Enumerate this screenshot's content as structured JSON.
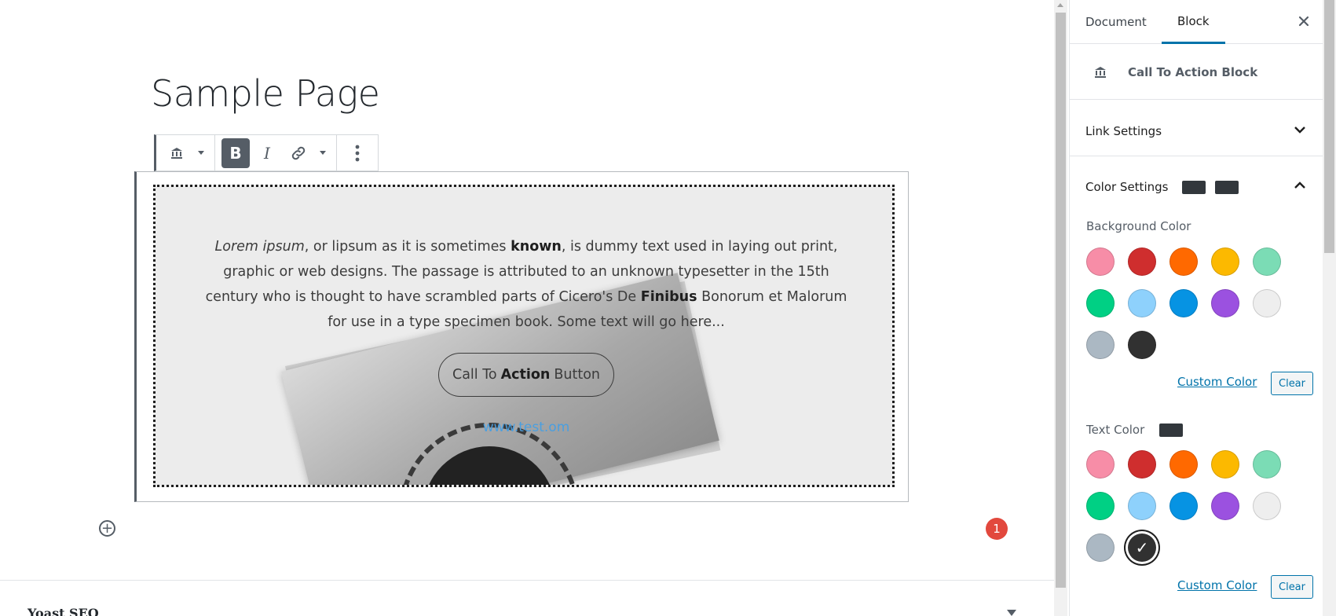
{
  "page": {
    "title": "Sample Page"
  },
  "toolbar": {
    "block_icon": "bank-icon",
    "bold_label": "B",
    "italic_label": "I"
  },
  "cta": {
    "text_parts": [
      {
        "t": "Lorem ipsum",
        "style": "italic"
      },
      {
        "t": ", or lipsum as it is sometimes ",
        "style": "normal"
      },
      {
        "t": "known",
        "style": "bold"
      },
      {
        "t": ", is dummy text used in laying out print, graphic or web designs. The passage is attributed to an unknown typesetter in the 15th century who is thought to have scrambled parts of Cicero's De ",
        "style": "normal"
      },
      {
        "t": "Finibus",
        "style": "bold"
      },
      {
        "t": " Bonorum et Malorum for use in a type specimen book.  Some text will go here...",
        "style": "normal"
      }
    ],
    "button_pre": "Call To",
    "button_bold": "Action",
    "button_post": "Button",
    "link_text": "www.test.om"
  },
  "editor": {
    "notification_count": "1",
    "yoast_label": "Yoast SEO"
  },
  "sidebar": {
    "tabs": [
      {
        "label": "Document",
        "active": false
      },
      {
        "label": "Block",
        "active": true
      }
    ],
    "block_card_title": "Call To Action Block",
    "link_settings_label": "Link Settings",
    "color_settings_label": "Color Settings",
    "background": {
      "label": "Background Color",
      "colors": [
        "#f78da7",
        "#cf2e2e",
        "#ff6900",
        "#fcb900",
        "#7bdcb5",
        "#00d084",
        "#8ed1fc",
        "#0693e3",
        "#9b51e0",
        "#eeeeee",
        "#abb8c3",
        "#313131"
      ],
      "selected_index": -1,
      "custom_label": "Custom Color",
      "clear_label": "Clear"
    },
    "text": {
      "label": "Text Color",
      "colors": [
        "#f78da7",
        "#cf2e2e",
        "#ff6900",
        "#fcb900",
        "#7bdcb5",
        "#00d084",
        "#8ed1fc",
        "#0693e3",
        "#9b51e0",
        "#eeeeee",
        "#abb8c3",
        "#313131"
      ],
      "selected_index": 11,
      "custom_label": "Custom Color",
      "clear_label": "Clear"
    },
    "indicator_color": "#32373c"
  },
  "colors": {
    "accent": "#0073aa",
    "badge": "#e2483d",
    "link": "#4a9fe0"
  }
}
